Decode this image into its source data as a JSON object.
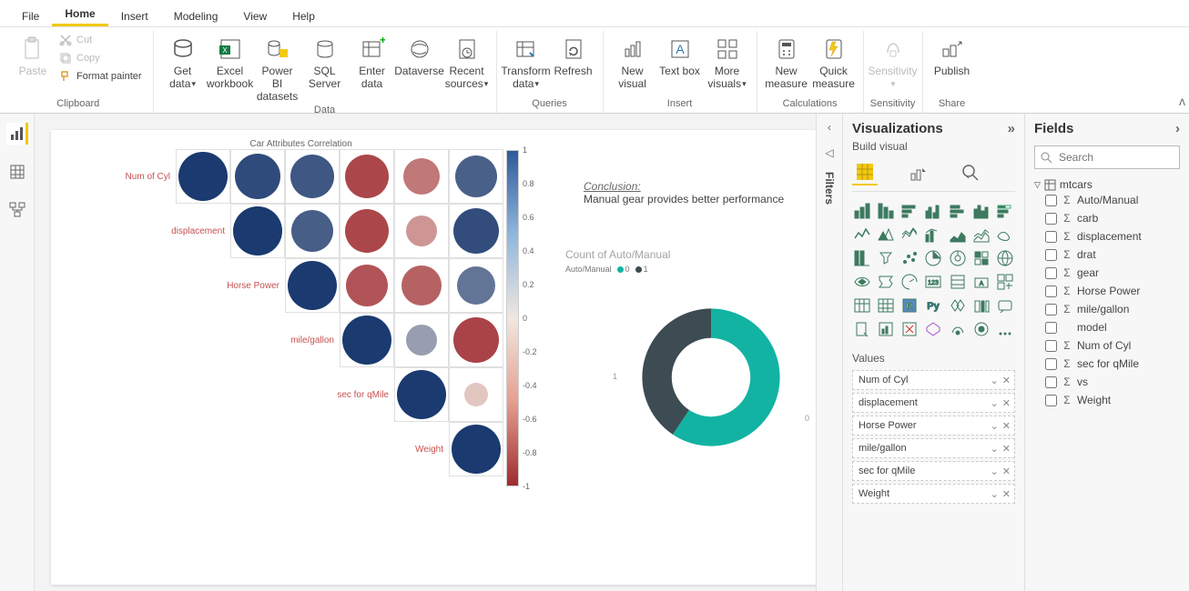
{
  "menu": {
    "tabs": [
      "File",
      "Home",
      "Insert",
      "Modeling",
      "View",
      "Help"
    ],
    "active": "Home"
  },
  "ribbon": {
    "clipboard": {
      "paste": "Paste",
      "cut": "Cut",
      "copy": "Copy",
      "format": "Format painter",
      "group": "Clipboard"
    },
    "data": {
      "get": "Get data",
      "excel": "Excel workbook",
      "pbids": "Power BI datasets",
      "sql": "SQL Server",
      "enter": "Enter data",
      "dv": "Dataverse",
      "recent": "Recent sources",
      "group": "Data"
    },
    "queries": {
      "transform": "Transform data",
      "refresh": "Refresh",
      "group": "Queries"
    },
    "insert": {
      "newv": "New visual",
      "textbox": "Text box",
      "more": "More visuals",
      "group": "Insert"
    },
    "calc": {
      "newm": "New measure",
      "quick": "Quick measure",
      "group": "Calculations"
    },
    "sens": {
      "label": "Sensitivity",
      "group": "Sensitivity"
    },
    "share": {
      "publish": "Publish",
      "group": "Share"
    }
  },
  "viz_pane": {
    "title": "Visualizations",
    "subtitle": "Build visual",
    "values_label": "Values",
    "wells": [
      "Num of Cyl",
      "displacement",
      "Horse Power",
      "mile/gallon",
      "sec for qMile",
      "Weight"
    ]
  },
  "fields_pane": {
    "title": "Fields",
    "search_ph": "Search",
    "table": "mtcars",
    "fields": [
      {
        "name": "Auto/Manual",
        "sigma": true
      },
      {
        "name": "carb",
        "sigma": true
      },
      {
        "name": "displacement",
        "sigma": true
      },
      {
        "name": "drat",
        "sigma": true
      },
      {
        "name": "gear",
        "sigma": true
      },
      {
        "name": "Horse Power",
        "sigma": true
      },
      {
        "name": "mile/gallon",
        "sigma": true
      },
      {
        "name": "model",
        "sigma": false
      },
      {
        "name": "Num of Cyl",
        "sigma": true
      },
      {
        "name": "sec for qMile",
        "sigma": true
      },
      {
        "name": "vs",
        "sigma": true
      },
      {
        "name": "Weight",
        "sigma": true
      }
    ]
  },
  "filters_label": "Filters",
  "textbox": {
    "head": "Conclusion:",
    "body": "Manual gear provides better performance"
  },
  "donut": {
    "title": "Count of Auto/Manual",
    "legend_label": "Auto/Manual",
    "legend": [
      "0",
      "1"
    ],
    "axis": [
      "1",
      "0"
    ]
  },
  "chart_data": [
    {
      "type": "heatmap",
      "title": "Car Attributes Correlation",
      "row_labels": [
        "Num of Cyl",
        "displacement",
        "Horse Power",
        "mile/gallon",
        "sec for qMile",
        "Weight"
      ],
      "col_labels": [
        "Num of Cyl",
        "displacement",
        "Horse Power",
        "mile/gallon",
        "sec for qMile",
        "Weight"
      ],
      "colorbar_ticks": [
        "1",
        "0.8",
        "0.6",
        "0.4",
        "0.2",
        "0",
        "-0.2",
        "-0.4",
        "-0.6",
        "-0.8",
        "-1"
      ],
      "matrix": [
        [
          1.0,
          0.9,
          0.83,
          -0.85,
          -0.59,
          0.78
        ],
        [
          null,
          1.0,
          0.79,
          -0.85,
          -0.43,
          0.89
        ],
        [
          null,
          null,
          1.0,
          -0.78,
          -0.71,
          0.66
        ],
        [
          null,
          null,
          null,
          1.0,
          0.42,
          -0.87
        ],
        [
          null,
          null,
          null,
          null,
          1.0,
          -0.17
        ],
        [
          null,
          null,
          null,
          null,
          null,
          1.0
        ]
      ]
    },
    {
      "type": "pie",
      "title": "Count of Auto/Manual",
      "series": [
        {
          "name": "0",
          "value": 19,
          "color": "#12b3a2"
        },
        {
          "name": "1",
          "value": 13,
          "color": "#3d4b52"
        }
      ]
    }
  ]
}
